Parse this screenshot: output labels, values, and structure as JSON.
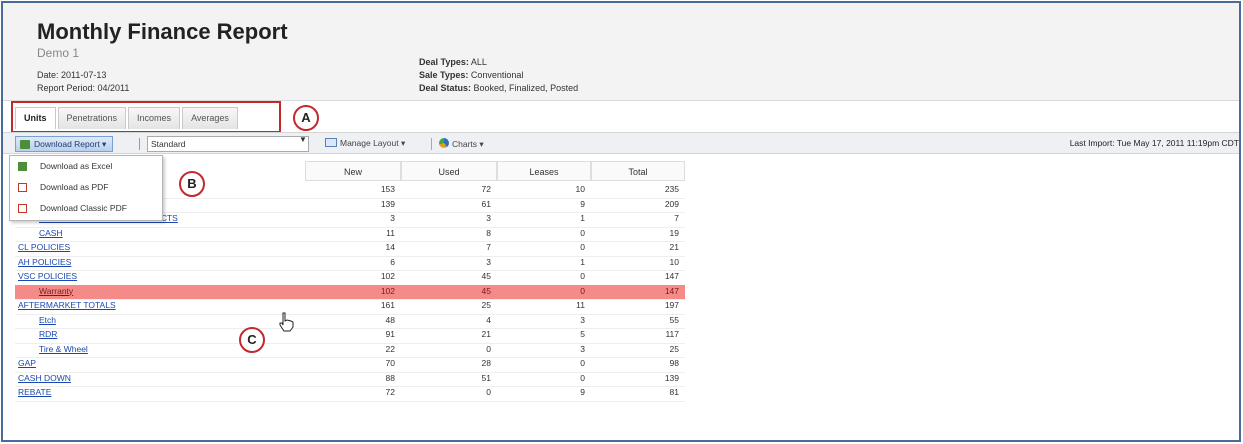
{
  "header": {
    "title": "Monthly Finance Report",
    "subtitle": "Demo 1",
    "date": "Date: 2011-07-13",
    "period": "Report Period: 04/2011",
    "deal_types_key": "Deal Types:",
    "deal_types_val": "ALL",
    "sale_types_key": "Sale Types:",
    "sale_types_val": "Conventional",
    "deal_status_key": "Deal Status:",
    "deal_status_val": "Booked, Finalized, Posted"
  },
  "tabs": [
    "Units",
    "Penetrations",
    "Incomes",
    "Averages"
  ],
  "callouts": {
    "a": "A",
    "b": "B",
    "c": "C"
  },
  "toolbar": {
    "download": "Download Report",
    "layout_select": "Standard",
    "manage_layout": "Manage Layout",
    "charts": "Charts",
    "last_import": "Last Import: Tue May 17, 2011 11:19pm CDT"
  },
  "menu": [
    "Download as Excel",
    "Download as PDF",
    "Download Classic PDF"
  ],
  "columns": [
    "New",
    "Used",
    "Leases",
    "Total"
  ],
  "rows": [
    {
      "label": "",
      "indent": false,
      "values": [
        "153",
        "72",
        "10",
        "235"
      ]
    },
    {
      "label": "",
      "indent": false,
      "values": [
        "139",
        "61",
        "9",
        "209"
      ]
    },
    {
      "label": "OUTSIDE FINANCED CONTRACTS",
      "indent": true,
      "values": [
        "3",
        "3",
        "1",
        "7"
      ]
    },
    {
      "label": "CASH",
      "indent": true,
      "values": [
        "11",
        "8",
        "0",
        "19"
      ]
    },
    {
      "label": "CL POLICIES",
      "indent": false,
      "values": [
        "14",
        "7",
        "0",
        "21"
      ]
    },
    {
      "label": "AH POLICIES",
      "indent": false,
      "values": [
        "6",
        "3",
        "1",
        "10"
      ]
    },
    {
      "label": "VSC POLICIES",
      "indent": false,
      "values": [
        "102",
        "45",
        "0",
        "147"
      ]
    },
    {
      "label": "Warranty",
      "indent": true,
      "highlight": true,
      "values": [
        "102",
        "45",
        "0",
        "147"
      ]
    },
    {
      "label": "AFTERMARKET TOTALS",
      "indent": false,
      "values": [
        "161",
        "25",
        "11",
        "197"
      ]
    },
    {
      "label": "Etch",
      "indent": true,
      "values": [
        "48",
        "4",
        "3",
        "55"
      ]
    },
    {
      "label": "RDR",
      "indent": true,
      "values": [
        "91",
        "21",
        "5",
        "117"
      ]
    },
    {
      "label": "Tire & Wheel",
      "indent": true,
      "values": [
        "22",
        "0",
        "3",
        "25"
      ]
    },
    {
      "label": "GAP",
      "indent": false,
      "values": [
        "70",
        "28",
        "0",
        "98"
      ]
    },
    {
      "label": "CASH DOWN",
      "indent": false,
      "values": [
        "88",
        "51",
        "0",
        "139"
      ]
    },
    {
      "label": "REBATE",
      "indent": false,
      "values": [
        "72",
        "0",
        "9",
        "81"
      ]
    }
  ]
}
